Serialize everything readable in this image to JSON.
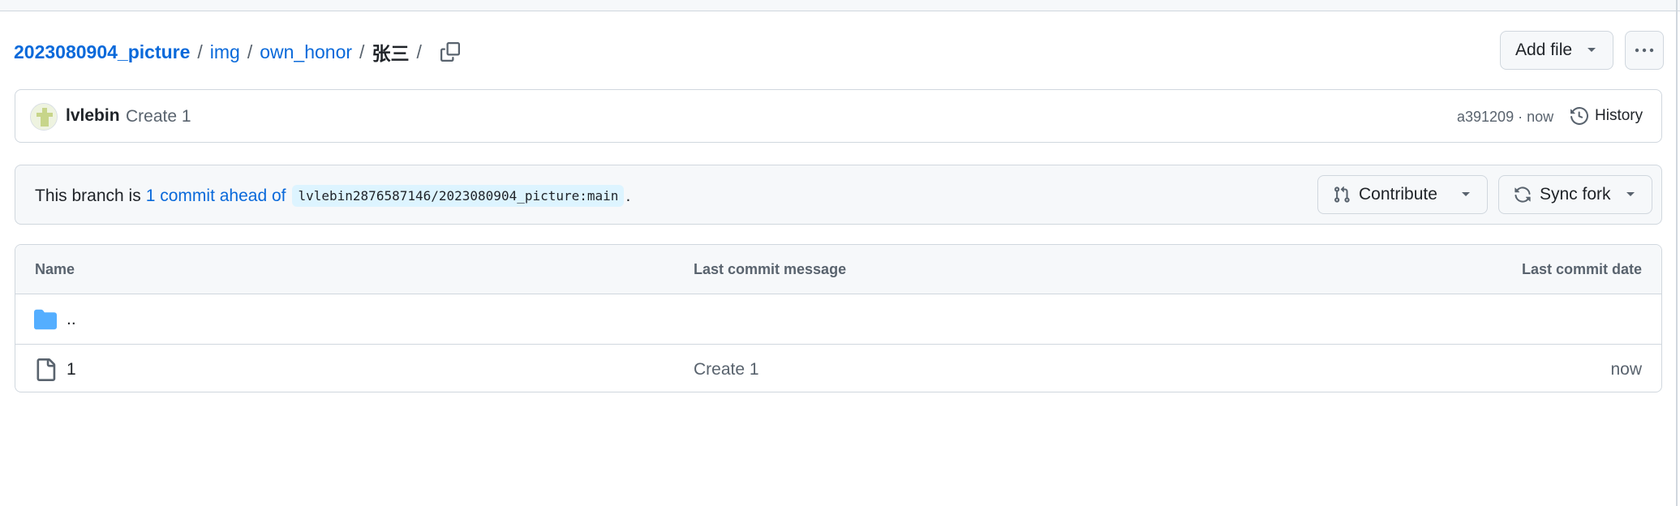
{
  "breadcrumb": {
    "repo": "2023080904_picture",
    "segments": [
      "img",
      "own_honor"
    ],
    "current": "张三",
    "separator": "/"
  },
  "actions": {
    "add_file_label": "Add file"
  },
  "latest_commit": {
    "author": "lvlebin",
    "message": "Create 1",
    "meta": "a391209 · now",
    "history_label": "History"
  },
  "branch_banner": {
    "prefix": "This branch is",
    "ahead_link": "1 commit ahead of",
    "upstream": "lvlebin2876587146/2023080904_picture:main",
    "suffix": ".",
    "contribute_label": "Contribute",
    "sync_label": "Sync fork"
  },
  "table": {
    "headers": {
      "name": "Name",
      "message": "Last commit message",
      "date": "Last commit date"
    },
    "rows": [
      {
        "icon": "folder-icon",
        "name": "..",
        "message": "",
        "date": ""
      },
      {
        "icon": "file-icon",
        "name": "1",
        "message": "Create 1",
        "date": "now"
      }
    ]
  },
  "colors": {
    "link": "#0969da",
    "muted": "#59636e",
    "border": "#d0d7de",
    "folder": "#54aeff"
  }
}
